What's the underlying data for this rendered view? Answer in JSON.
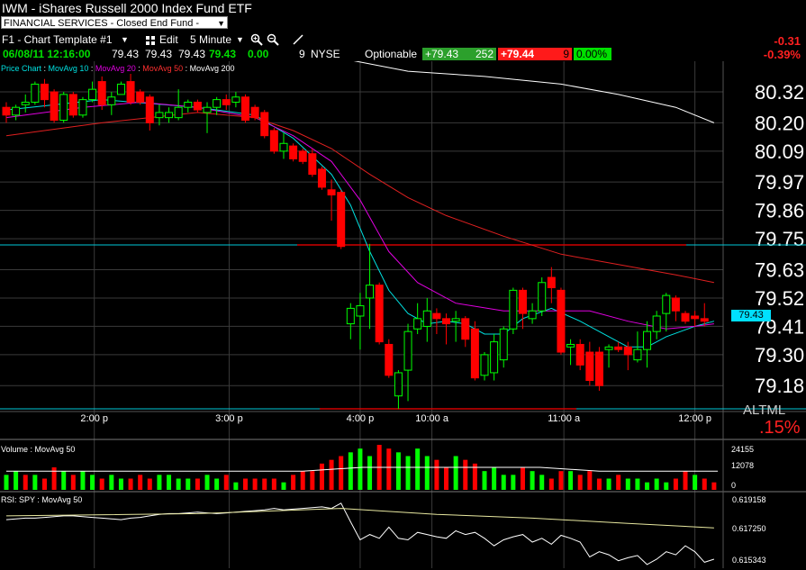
{
  "header": {
    "title": "IWM - iShares Russell 2000 Index Fund ETF",
    "sector": "FINANCIAL SERVICES - Closed End Fund - Equity",
    "template": "F1 - Chart Template #1",
    "edit_label": "Edit",
    "interval": "5 Minute",
    "change_abs": "-0.31",
    "change_pct": "-0.39%"
  },
  "quote": {
    "datetime": "06/08/11 12:16:00",
    "open": "79.43",
    "high": "79.43",
    "low": "79.43",
    "last": "79.43",
    "change": "0.00",
    "exch_count": "9",
    "exchange": "NYSE",
    "optionable": "Optionable",
    "bid": "+79.43",
    "bid_size": "252",
    "ask": "+79.44",
    "ask_size": "9",
    "pct": "0.00%"
  },
  "colors": {
    "up": "#00ff00",
    "down": "#ff0000",
    "ma10": "#00e0e0",
    "ma20": "#e000e0",
    "ma50": "#e02020",
    "ma200": "#ffffff"
  },
  "price_panel": {
    "legend": [
      "Price Chart",
      "MovAvg 10",
      "MovAvg 20",
      "MovAvg 50",
      "MovAvg 200"
    ],
    "last_marker": "79.43",
    "corner_text_1": "AL",
    "corner_text_2": "TML",
    "corner_pct": ".15%"
  },
  "volume_panel": {
    "label": "Volume : MovAvg 50",
    "ticks": [
      "24155",
      "12078",
      "0"
    ]
  },
  "rsi_panel": {
    "label": "RSI: SPY : MovAvg 50",
    "ticks": [
      "0.619158",
      "0.617250",
      "0.615343"
    ]
  },
  "chart_data": {
    "type": "candlestick",
    "title": "IWM - iShares Russell 2000 Index Fund ETF",
    "interval": "5 Minute",
    "x_tick_labels": [
      "2:00 p",
      "3:00 p",
      "4:00 p",
      "10:00 a",
      "11:00 a",
      "12:00 p"
    ],
    "y_tick_labels": [
      80.32,
      80.2,
      80.09,
      79.97,
      79.86,
      79.75,
      79.63,
      79.52,
      79.41,
      79.3,
      79.18
    ],
    "ylim": [
      79.09,
      80.39
    ],
    "candles": [
      {
        "o": 80.26,
        "h": 80.28,
        "l": 80.2,
        "c": 80.23
      },
      {
        "o": 80.23,
        "h": 80.27,
        "l": 80.21,
        "c": 80.26
      },
      {
        "o": 80.27,
        "h": 80.31,
        "l": 80.24,
        "c": 80.28
      },
      {
        "o": 80.28,
        "h": 80.36,
        "l": 80.27,
        "c": 80.35
      },
      {
        "o": 80.35,
        "h": 80.37,
        "l": 80.26,
        "c": 80.29
      },
      {
        "o": 80.32,
        "h": 80.33,
        "l": 80.2,
        "c": 80.21
      },
      {
        "o": 80.21,
        "h": 80.32,
        "l": 80.2,
        "c": 80.31
      },
      {
        "o": 80.31,
        "h": 80.32,
        "l": 80.22,
        "c": 80.23
      },
      {
        "o": 80.23,
        "h": 80.3,
        "l": 80.22,
        "c": 80.29
      },
      {
        "o": 80.29,
        "h": 80.36,
        "l": 80.28,
        "c": 80.33
      },
      {
        "o": 80.36,
        "h": 80.38,
        "l": 80.25,
        "c": 80.27
      },
      {
        "o": 80.27,
        "h": 80.32,
        "l": 80.23,
        "c": 80.3
      },
      {
        "o": 80.31,
        "h": 80.36,
        "l": 80.31,
        "c": 80.35
      },
      {
        "o": 80.36,
        "h": 80.39,
        "l": 80.27,
        "c": 80.28
      },
      {
        "o": 80.32,
        "h": 80.33,
        "l": 80.27,
        "c": 80.28
      },
      {
        "o": 80.3,
        "h": 80.31,
        "l": 80.17,
        "c": 80.2
      },
      {
        "o": 80.22,
        "h": 80.27,
        "l": 80.19,
        "c": 80.24
      },
      {
        "o": 80.22,
        "h": 80.26,
        "l": 80.2,
        "c": 80.24
      },
      {
        "o": 80.22,
        "h": 80.33,
        "l": 80.21,
        "c": 80.26
      },
      {
        "o": 80.26,
        "h": 80.29,
        "l": 80.24,
        "c": 80.28
      },
      {
        "o": 80.28,
        "h": 80.29,
        "l": 80.24,
        "c": 80.25
      },
      {
        "o": 80.24,
        "h": 80.28,
        "l": 80.16,
        "c": 80.26
      },
      {
        "o": 80.26,
        "h": 80.3,
        "l": 80.23,
        "c": 80.29
      },
      {
        "o": 80.29,
        "h": 80.31,
        "l": 80.25,
        "c": 80.27
      },
      {
        "o": 80.28,
        "h": 80.32,
        "l": 80.26,
        "c": 80.3
      },
      {
        "o": 80.3,
        "h": 80.31,
        "l": 80.2,
        "c": 80.21
      },
      {
        "o": 80.26,
        "h": 80.27,
        "l": 80.21,
        "c": 80.22
      },
      {
        "o": 80.24,
        "h": 80.25,
        "l": 80.14,
        "c": 80.15
      },
      {
        "o": 80.17,
        "h": 80.18,
        "l": 80.08,
        "c": 80.09
      },
      {
        "o": 80.09,
        "h": 80.16,
        "l": 80.06,
        "c": 80.12
      },
      {
        "o": 80.11,
        "h": 80.12,
        "l": 80.05,
        "c": 80.06
      },
      {
        "o": 80.09,
        "h": 80.1,
        "l": 80.04,
        "c": 80.05
      },
      {
        "o": 80.08,
        "h": 80.1,
        "l": 79.99,
        "c": 80.0
      },
      {
        "o": 80.02,
        "h": 80.03,
        "l": 79.94,
        "c": 79.95
      },
      {
        "o": 79.94,
        "h": 79.98,
        "l": 79.82,
        "c": 79.92
      },
      {
        "o": 79.93,
        "h": 79.94,
        "l": 79.71,
        "c": 79.72
      },
      {
        "o": 79.42,
        "h": 79.5,
        "l": 79.36,
        "c": 79.48
      },
      {
        "o": 79.45,
        "h": 79.54,
        "l": 79.32,
        "c": 79.49
      },
      {
        "o": 79.52,
        "h": 79.73,
        "l": 79.4,
        "c": 79.57
      },
      {
        "o": 79.57,
        "h": 79.58,
        "l": 79.34,
        "c": 79.35
      },
      {
        "o": 79.34,
        "h": 79.36,
        "l": 79.21,
        "c": 79.22
      },
      {
        "o": 79.14,
        "h": 79.24,
        "l": 79.09,
        "c": 79.23
      },
      {
        "o": 79.24,
        "h": 79.42,
        "l": 79.12,
        "c": 79.39
      },
      {
        "o": 79.4,
        "h": 79.5,
        "l": 79.38,
        "c": 79.44
      },
      {
        "o": 79.41,
        "h": 79.52,
        "l": 79.35,
        "c": 79.47
      },
      {
        "o": 79.46,
        "h": 79.48,
        "l": 79.38,
        "c": 79.44
      },
      {
        "o": 79.44,
        "h": 79.46,
        "l": 79.34,
        "c": 79.42
      },
      {
        "o": 79.43,
        "h": 79.47,
        "l": 79.35,
        "c": 79.44
      },
      {
        "o": 79.44,
        "h": 79.45,
        "l": 79.33,
        "c": 79.36
      },
      {
        "o": 79.4,
        "h": 79.43,
        "l": 79.2,
        "c": 79.21
      },
      {
        "o": 79.22,
        "h": 79.31,
        "l": 79.2,
        "c": 79.3
      },
      {
        "o": 79.23,
        "h": 79.38,
        "l": 79.2,
        "c": 79.35
      },
      {
        "o": 79.28,
        "h": 79.41,
        "l": 79.25,
        "c": 79.4
      },
      {
        "o": 79.4,
        "h": 79.56,
        "l": 79.38,
        "c": 79.55
      },
      {
        "o": 79.55,
        "h": 79.56,
        "l": 79.4,
        "c": 79.46
      },
      {
        "o": 79.44,
        "h": 79.5,
        "l": 79.42,
        "c": 79.47
      },
      {
        "o": 79.47,
        "h": 79.6,
        "l": 79.45,
        "c": 79.58
      },
      {
        "o": 79.6,
        "h": 79.64,
        "l": 79.5,
        "c": 79.56
      },
      {
        "o": 79.55,
        "h": 79.56,
        "l": 79.3,
        "c": 79.31
      },
      {
        "o": 79.33,
        "h": 79.36,
        "l": 79.26,
        "c": 79.34
      },
      {
        "o": 79.34,
        "h": 79.36,
        "l": 79.24,
        "c": 79.26
      },
      {
        "o": 79.31,
        "h": 79.35,
        "l": 79.18,
        "c": 79.2
      },
      {
        "o": 79.31,
        "h": 79.33,
        "l": 79.16,
        "c": 79.18
      },
      {
        "o": 79.32,
        "h": 79.34,
        "l": 79.25,
        "c": 79.33
      },
      {
        "o": 79.33,
        "h": 79.35,
        "l": 79.31,
        "c": 79.32
      },
      {
        "o": 79.33,
        "h": 79.35,
        "l": 79.24,
        "c": 79.3
      },
      {
        "o": 79.28,
        "h": 79.39,
        "l": 79.27,
        "c": 79.32
      },
      {
        "o": 79.32,
        "h": 79.43,
        "l": 79.25,
        "c": 79.39
      },
      {
        "o": 79.39,
        "h": 79.47,
        "l": 79.36,
        "c": 79.45
      },
      {
        "o": 79.46,
        "h": 79.54,
        "l": 79.39,
        "c": 79.53
      },
      {
        "o": 79.52,
        "h": 79.53,
        "l": 79.43,
        "c": 79.47
      },
      {
        "o": 79.46,
        "h": 79.47,
        "l": 79.42,
        "c": 79.43
      },
      {
        "o": 79.45,
        "h": 79.47,
        "l": 79.41,
        "c": 79.44
      },
      {
        "o": 79.44,
        "h": 79.5,
        "l": 79.41,
        "c": 79.43
      }
    ],
    "series": [
      {
        "name": "MovAvg 10",
        "values": [
          [
            0,
            80.25
          ],
          [
            10,
            80.29
          ],
          [
            20,
            80.26
          ],
          [
            26,
            80.23
          ],
          [
            30,
            80.14
          ],
          [
            34,
            80.0
          ],
          [
            36,
            79.88
          ],
          [
            38,
            79.7
          ],
          [
            40,
            79.55
          ],
          [
            42,
            79.46
          ],
          [
            44,
            79.42
          ],
          [
            46,
            79.43
          ],
          [
            48,
            79.42
          ],
          [
            50,
            79.38
          ],
          [
            52,
            79.38
          ],
          [
            54,
            79.44
          ],
          [
            57,
            79.48
          ],
          [
            60,
            79.43
          ],
          [
            63,
            79.37
          ],
          [
            65,
            79.33
          ],
          [
            67,
            79.33
          ],
          [
            69,
            79.37
          ],
          [
            72,
            79.41
          ],
          [
            74,
            79.43
          ]
        ]
      },
      {
        "name": "MovAvg 20",
        "values": [
          [
            0,
            80.22
          ],
          [
            8,
            80.26
          ],
          [
            14,
            80.28
          ],
          [
            20,
            80.26
          ],
          [
            26,
            80.22
          ],
          [
            30,
            80.15
          ],
          [
            34,
            80.05
          ],
          [
            37,
            79.9
          ],
          [
            40,
            79.7
          ],
          [
            43,
            79.58
          ],
          [
            47,
            79.5
          ],
          [
            52,
            79.47
          ],
          [
            57,
            79.47
          ],
          [
            61,
            79.47
          ],
          [
            65,
            79.43
          ],
          [
            69,
            79.4
          ],
          [
            72,
            79.41
          ],
          [
            74,
            79.42
          ]
        ]
      },
      {
        "name": "MovAvg 50",
        "values": [
          [
            0,
            80.15
          ],
          [
            10,
            80.2
          ],
          [
            20,
            80.24
          ],
          [
            26,
            80.22
          ],
          [
            30,
            80.17
          ],
          [
            34,
            80.1
          ],
          [
            38,
            80.0
          ],
          [
            42,
            79.91
          ],
          [
            46,
            79.84
          ],
          [
            52,
            79.76
          ],
          [
            58,
            79.69
          ],
          [
            64,
            79.65
          ],
          [
            70,
            79.61
          ],
          [
            74,
            79.58
          ]
        ]
      },
      {
        "name": "MovAvg 200",
        "values": [
          [
            35,
            80.45
          ],
          [
            42,
            80.4
          ],
          [
            50,
            80.38
          ],
          [
            58,
            80.35
          ],
          [
            64,
            80.31
          ],
          [
            70,
            80.26
          ],
          [
            74,
            80.2
          ]
        ]
      }
    ],
    "volume": [
      4,
      5,
      4,
      4,
      3,
      6,
      5,
      4,
      5,
      4,
      3,
      4,
      3,
      3,
      4,
      3,
      4,
      4,
      3,
      3,
      3,
      4,
      3,
      4,
      2,
      3,
      3,
      3,
      3,
      2,
      4,
      5,
      5,
      7,
      8,
      9,
      10,
      11,
      9,
      12,
      11,
      10,
      9,
      11,
      9,
      8,
      6,
      9,
      8,
      7,
      5,
      6,
      4,
      4,
      6,
      5,
      4,
      3,
      5,
      5,
      4,
      5,
      3,
      3,
      4,
      3,
      3,
      2,
      3,
      2,
      3,
      5,
      4,
      3,
      2
    ],
    "volume_up": [
      1,
      1,
      0,
      1,
      0,
      0,
      1,
      0,
      1,
      1,
      0,
      1,
      1,
      0,
      0,
      0,
      1,
      1,
      1,
      1,
      0,
      1,
      1,
      0,
      1,
      0,
      0,
      0,
      0,
      1,
      0,
      0,
      0,
      0,
      0,
      0,
      1,
      1,
      1,
      0,
      0,
      1,
      1,
      1,
      1,
      0,
      0,
      1,
      0,
      0,
      1,
      1,
      1,
      1,
      0,
      1,
      1,
      0,
      0,
      1,
      0,
      0,
      0,
      1,
      0,
      1,
      1,
      1,
      1,
      1,
      0,
      0,
      1,
      0,
      0
    ]
  }
}
